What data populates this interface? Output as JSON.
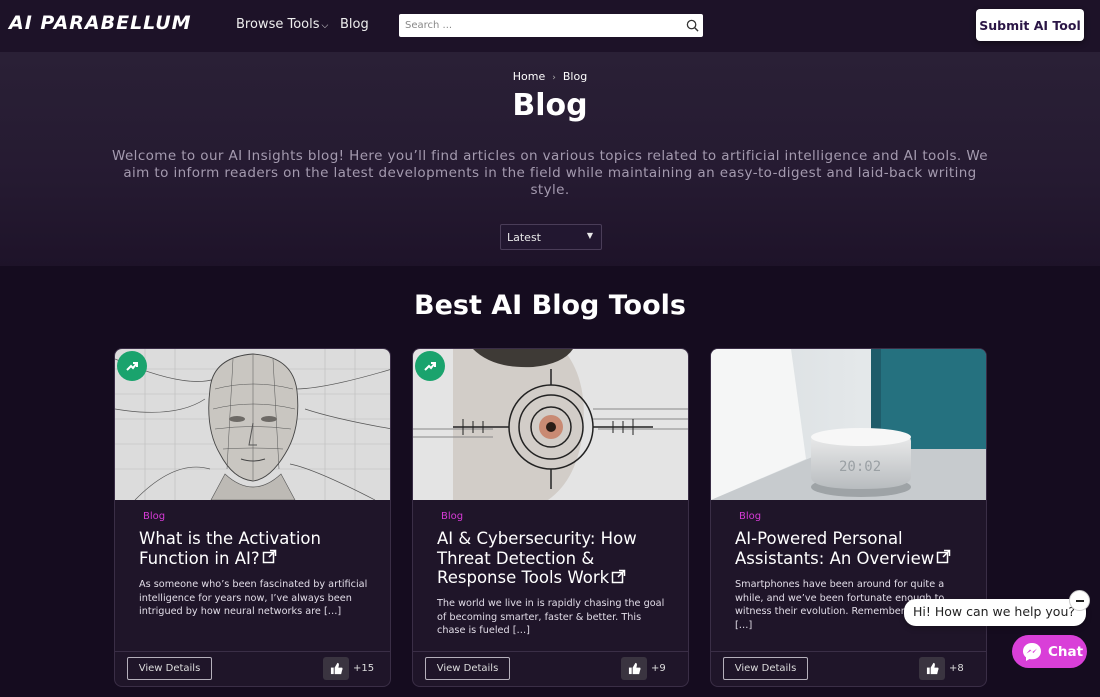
{
  "header": {
    "logo": "AI PARABELLUM",
    "nav": {
      "browse": "Browse Tools",
      "blog": "Blog"
    },
    "search_placeholder": "Search ...",
    "submit": "Submit AI Tool"
  },
  "hero": {
    "breadcrumb": {
      "home": "Home",
      "current": "Blog"
    },
    "title": "Blog",
    "description": "Welcome to our AI Insights blog! Here you’ll find articles on various topics related to artificial intelligence and AI tools. We aim to inform readers on the latest developments in the field while maintaining an easy-to-digest and laid-back writing style.",
    "sort": "Latest"
  },
  "section": {
    "title": "Best AI Blog Tools"
  },
  "cards": [
    {
      "category": "Blog",
      "title": "What is the Activation Function in AI?",
      "excerpt": "As someone who’s been fascinated by artificial intelligence for years now, I’ve always been intrigued by how neural networks are […]",
      "details": "View Details",
      "likes": "+15",
      "trending": true
    },
    {
      "category": "Blog",
      "title": "AI & Cybersecurity: How Threat Detection & Response Tools Work",
      "excerpt": "The world we live in is rapidly chasing the goal of becoming smarter, faster & better. This chase is fueled […]",
      "details": "View Details",
      "likes": "+9",
      "trending": true
    },
    {
      "category": "Blog",
      "title": "AI-Powered Personal Assistants: An Overview",
      "excerpt": "Smartphones have been around for quite a while, and we’ve been fortunate enough to witness their evolution. Remember the unreal […]",
      "details": "View Details",
      "likes": "+8",
      "trending": false
    }
  ],
  "chat": {
    "greeting": "Hi! How can we help you?",
    "button": "Chat"
  },
  "colors": {
    "background": "#150c1f",
    "header": "#1d1228",
    "accent_magenta": "#d93fd8",
    "trending_green": "#1aa36d"
  }
}
